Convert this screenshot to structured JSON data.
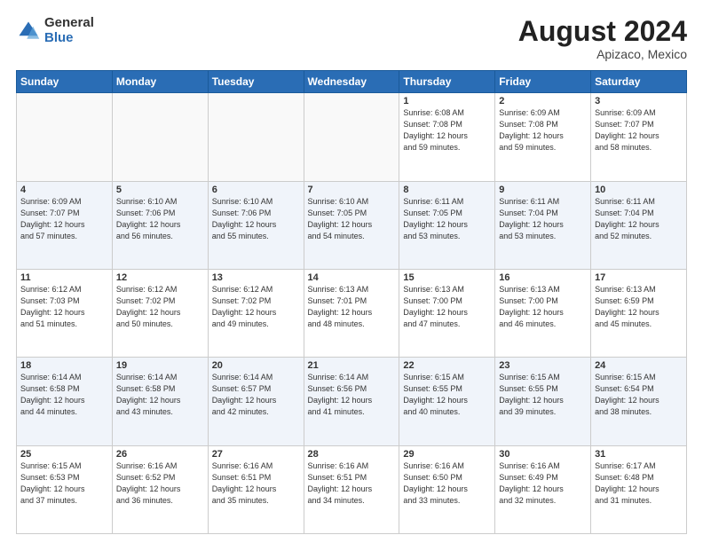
{
  "logo": {
    "general": "General",
    "blue": "Blue"
  },
  "header": {
    "month_year": "August 2024",
    "location": "Apizaco, Mexico"
  },
  "days_of_week": [
    "Sunday",
    "Monday",
    "Tuesday",
    "Wednesday",
    "Thursday",
    "Friday",
    "Saturday"
  ],
  "weeks": [
    [
      {
        "day": "",
        "info": ""
      },
      {
        "day": "",
        "info": ""
      },
      {
        "day": "",
        "info": ""
      },
      {
        "day": "",
        "info": ""
      },
      {
        "day": "1",
        "info": "Sunrise: 6:08 AM\nSunset: 7:08 PM\nDaylight: 12 hours\nand 59 minutes."
      },
      {
        "day": "2",
        "info": "Sunrise: 6:09 AM\nSunset: 7:08 PM\nDaylight: 12 hours\nand 59 minutes."
      },
      {
        "day": "3",
        "info": "Sunrise: 6:09 AM\nSunset: 7:07 PM\nDaylight: 12 hours\nand 58 minutes."
      }
    ],
    [
      {
        "day": "4",
        "info": "Sunrise: 6:09 AM\nSunset: 7:07 PM\nDaylight: 12 hours\nand 57 minutes."
      },
      {
        "day": "5",
        "info": "Sunrise: 6:10 AM\nSunset: 7:06 PM\nDaylight: 12 hours\nand 56 minutes."
      },
      {
        "day": "6",
        "info": "Sunrise: 6:10 AM\nSunset: 7:06 PM\nDaylight: 12 hours\nand 55 minutes."
      },
      {
        "day": "7",
        "info": "Sunrise: 6:10 AM\nSunset: 7:05 PM\nDaylight: 12 hours\nand 54 minutes."
      },
      {
        "day": "8",
        "info": "Sunrise: 6:11 AM\nSunset: 7:05 PM\nDaylight: 12 hours\nand 53 minutes."
      },
      {
        "day": "9",
        "info": "Sunrise: 6:11 AM\nSunset: 7:04 PM\nDaylight: 12 hours\nand 53 minutes."
      },
      {
        "day": "10",
        "info": "Sunrise: 6:11 AM\nSunset: 7:04 PM\nDaylight: 12 hours\nand 52 minutes."
      }
    ],
    [
      {
        "day": "11",
        "info": "Sunrise: 6:12 AM\nSunset: 7:03 PM\nDaylight: 12 hours\nand 51 minutes."
      },
      {
        "day": "12",
        "info": "Sunrise: 6:12 AM\nSunset: 7:02 PM\nDaylight: 12 hours\nand 50 minutes."
      },
      {
        "day": "13",
        "info": "Sunrise: 6:12 AM\nSunset: 7:02 PM\nDaylight: 12 hours\nand 49 minutes."
      },
      {
        "day": "14",
        "info": "Sunrise: 6:13 AM\nSunset: 7:01 PM\nDaylight: 12 hours\nand 48 minutes."
      },
      {
        "day": "15",
        "info": "Sunrise: 6:13 AM\nSunset: 7:00 PM\nDaylight: 12 hours\nand 47 minutes."
      },
      {
        "day": "16",
        "info": "Sunrise: 6:13 AM\nSunset: 7:00 PM\nDaylight: 12 hours\nand 46 minutes."
      },
      {
        "day": "17",
        "info": "Sunrise: 6:13 AM\nSunset: 6:59 PM\nDaylight: 12 hours\nand 45 minutes."
      }
    ],
    [
      {
        "day": "18",
        "info": "Sunrise: 6:14 AM\nSunset: 6:58 PM\nDaylight: 12 hours\nand 44 minutes."
      },
      {
        "day": "19",
        "info": "Sunrise: 6:14 AM\nSunset: 6:58 PM\nDaylight: 12 hours\nand 43 minutes."
      },
      {
        "day": "20",
        "info": "Sunrise: 6:14 AM\nSunset: 6:57 PM\nDaylight: 12 hours\nand 42 minutes."
      },
      {
        "day": "21",
        "info": "Sunrise: 6:14 AM\nSunset: 6:56 PM\nDaylight: 12 hours\nand 41 minutes."
      },
      {
        "day": "22",
        "info": "Sunrise: 6:15 AM\nSunset: 6:55 PM\nDaylight: 12 hours\nand 40 minutes."
      },
      {
        "day": "23",
        "info": "Sunrise: 6:15 AM\nSunset: 6:55 PM\nDaylight: 12 hours\nand 39 minutes."
      },
      {
        "day": "24",
        "info": "Sunrise: 6:15 AM\nSunset: 6:54 PM\nDaylight: 12 hours\nand 38 minutes."
      }
    ],
    [
      {
        "day": "25",
        "info": "Sunrise: 6:15 AM\nSunset: 6:53 PM\nDaylight: 12 hours\nand 37 minutes."
      },
      {
        "day": "26",
        "info": "Sunrise: 6:16 AM\nSunset: 6:52 PM\nDaylight: 12 hours\nand 36 minutes."
      },
      {
        "day": "27",
        "info": "Sunrise: 6:16 AM\nSunset: 6:51 PM\nDaylight: 12 hours\nand 35 minutes."
      },
      {
        "day": "28",
        "info": "Sunrise: 6:16 AM\nSunset: 6:51 PM\nDaylight: 12 hours\nand 34 minutes."
      },
      {
        "day": "29",
        "info": "Sunrise: 6:16 AM\nSunset: 6:50 PM\nDaylight: 12 hours\nand 33 minutes."
      },
      {
        "day": "30",
        "info": "Sunrise: 6:16 AM\nSunset: 6:49 PM\nDaylight: 12 hours\nand 32 minutes."
      },
      {
        "day": "31",
        "info": "Sunrise: 6:17 AM\nSunset: 6:48 PM\nDaylight: 12 hours\nand 31 minutes."
      }
    ]
  ]
}
